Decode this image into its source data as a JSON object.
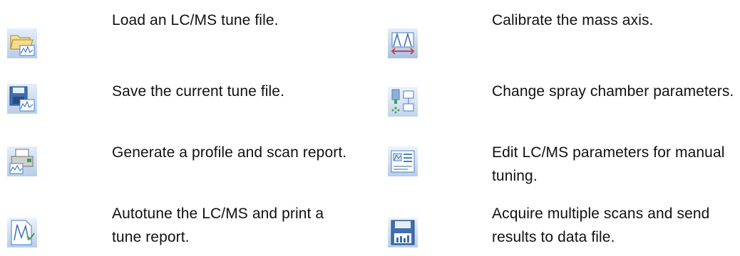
{
  "left_column": [
    {
      "icon": "folder-open-chart-icon",
      "text": "Load an LC/MS tune file."
    },
    {
      "icon": "save-disk-chart-icon",
      "text": "Save the current tune file."
    },
    {
      "icon": "printer-report-icon",
      "text": "Generate a profile and scan report."
    },
    {
      "icon": "autotune-chart-icon",
      "text": "Autotune the LC/MS and print a tune report."
    }
  ],
  "right_column": [
    {
      "icon": "calibrate-mass-axis-icon",
      "text": "Calibrate the mass axis."
    },
    {
      "icon": "spray-chamber-icon",
      "text": "Change spray chamber parameters."
    },
    {
      "icon": "edit-parameters-icon",
      "text": "Edit LC/MS parameters for manual tuning."
    },
    {
      "icon": "acquire-scans-disk-icon",
      "text": "Acquire multiple scans and send results to data file."
    }
  ],
  "colors": {
    "icon_blue": "#4a7fc1",
    "icon_light_blue": "#c9daf0",
    "icon_green": "#3aa54a",
    "icon_yellow": "#e9c65a",
    "text": "#111111"
  }
}
